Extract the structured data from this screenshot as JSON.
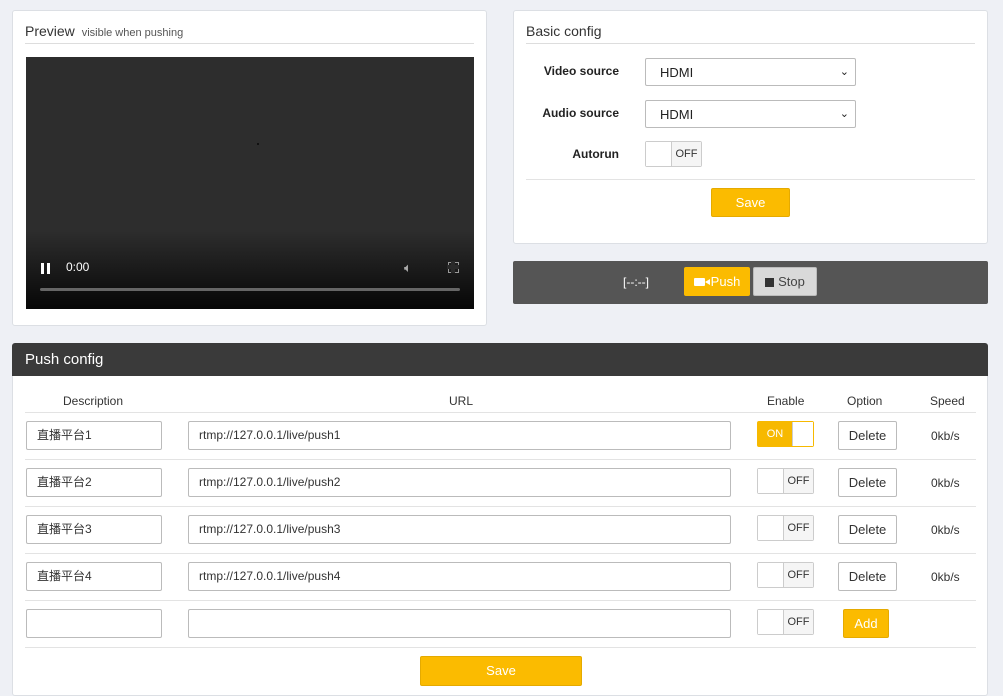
{
  "preview": {
    "title": "Preview",
    "subtitle": "visible when pushing",
    "player": {
      "time": "0:00"
    }
  },
  "basic_config": {
    "title": "Basic config",
    "video_source": {
      "label": "Video source",
      "value": "HDMI"
    },
    "audio_source": {
      "label": "Audio source",
      "value": "HDMI"
    },
    "autorun": {
      "label": "Autorun",
      "state": "OFF"
    },
    "save_label": "Save"
  },
  "controls": {
    "timer": "[--:--]",
    "push_label": "Push",
    "stop_label": "Stop"
  },
  "push_config": {
    "title": "Push config",
    "columns": [
      "Description",
      "URL",
      "Enable",
      "Option",
      "Speed"
    ],
    "rows": [
      {
        "description": "直播平台1",
        "url": "rtmp://127.0.0.1/live/push1",
        "enable": "ON",
        "option": "Delete",
        "speed": "0kb/s"
      },
      {
        "description": "直播平台2",
        "url": "rtmp://127.0.0.1/live/push2",
        "enable": "OFF",
        "option": "Delete",
        "speed": "0kb/s"
      },
      {
        "description": "直播平台3",
        "url": "rtmp://127.0.0.1/live/push3",
        "enable": "OFF",
        "option": "Delete",
        "speed": "0kb/s"
      },
      {
        "description": "直播平台4",
        "url": "rtmp://127.0.0.1/live/push4",
        "enable": "OFF",
        "option": "Delete",
        "speed": "0kb/s"
      }
    ],
    "new_row": {
      "description": "",
      "url": "",
      "enable": "OFF",
      "add_label": "Add"
    },
    "save_label": "Save"
  },
  "colors": {
    "accent": "#fbbb00",
    "header_dark": "#3a3a3a",
    "control_bar": "#555555"
  }
}
